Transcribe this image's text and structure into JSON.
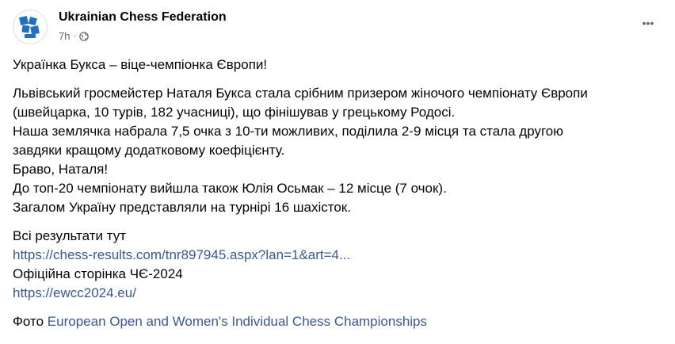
{
  "header": {
    "author": "Ukrainian Chess Federation",
    "time": "7h",
    "dot": "·",
    "icons": {
      "privacy": "globe-icon",
      "more": "more-horizontal-icon"
    },
    "more_label": "•••"
  },
  "post": {
    "title": "Українка Букса – віце-чемпіонка Європи!",
    "lines": [
      "Львівський гросмейстер Наталя Букса стала срібним призером жіночого чемпіонату Європи",
      "(швейцарка, 10 турів, 182 учасниці), що фінішував у грецькому Родосі.",
      "Наша землячка набрала 7,5 очка з 10-ти можливих, поділила 2-9 місця та стала другою",
      "завдяки кращому додатковому коефіцієнту.",
      "Браво, Наталя!",
      "До топ-20 чемпіонату вийшла також Юлія Осьмак – 12 місце (7 очок).",
      "Загалом Україну представляли на турнірі 16 шахісток."
    ],
    "results_label": "Всі результати тут",
    "results_link": "https://chess-results.com/tnr897945.aspx?lan=1&art=4...",
    "official_label": "Офіційна сторінка ЧЄ-2024",
    "official_link": "https://ewcc2024.eu/",
    "photo_prefix": "Фото",
    "photo_link": "European Open and Women's Individual Chess Championships"
  },
  "colors": {
    "link": "#385898",
    "text": "#050505",
    "secondary": "#65676b",
    "logo_blue": "#1f6fc5"
  }
}
